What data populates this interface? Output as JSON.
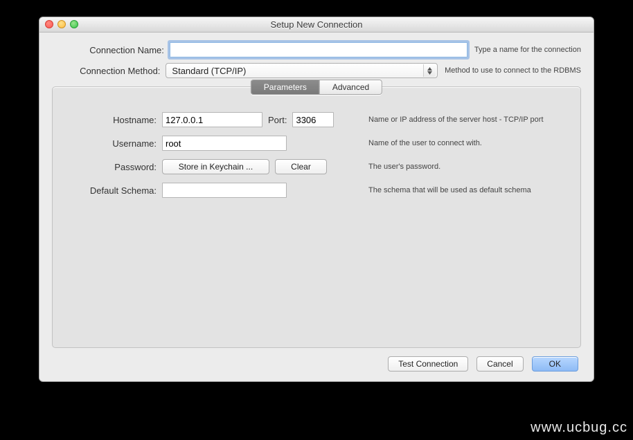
{
  "window": {
    "title": "Setup New Connection"
  },
  "top": {
    "conn_name_label": "Connection Name:",
    "conn_name_value": "",
    "conn_name_hint": "Type a name for the connection",
    "conn_method_label": "Connection Method:",
    "conn_method_value": "Standard (TCP/IP)",
    "conn_method_hint": "Method to use to connect to the RDBMS"
  },
  "tabs": {
    "parameters": "Parameters",
    "advanced": "Advanced"
  },
  "params": {
    "hostname_label": "Hostname:",
    "hostname_value": "127.0.0.1",
    "port_label": "Port:",
    "port_value": "3306",
    "host_hint": "Name or IP address of the server host - TCP/IP port",
    "username_label": "Username:",
    "username_value": "root",
    "username_hint": "Name of the user to connect with.",
    "password_label": "Password:",
    "store_button": "Store in Keychain ...",
    "clear_button": "Clear",
    "password_hint": "The user's password.",
    "schema_label": "Default Schema:",
    "schema_value": "",
    "schema_hint": "The schema that will be used as default schema"
  },
  "footer": {
    "test": "Test Connection",
    "cancel": "Cancel",
    "ok": "OK"
  },
  "watermark": "www.ucbug.cc"
}
